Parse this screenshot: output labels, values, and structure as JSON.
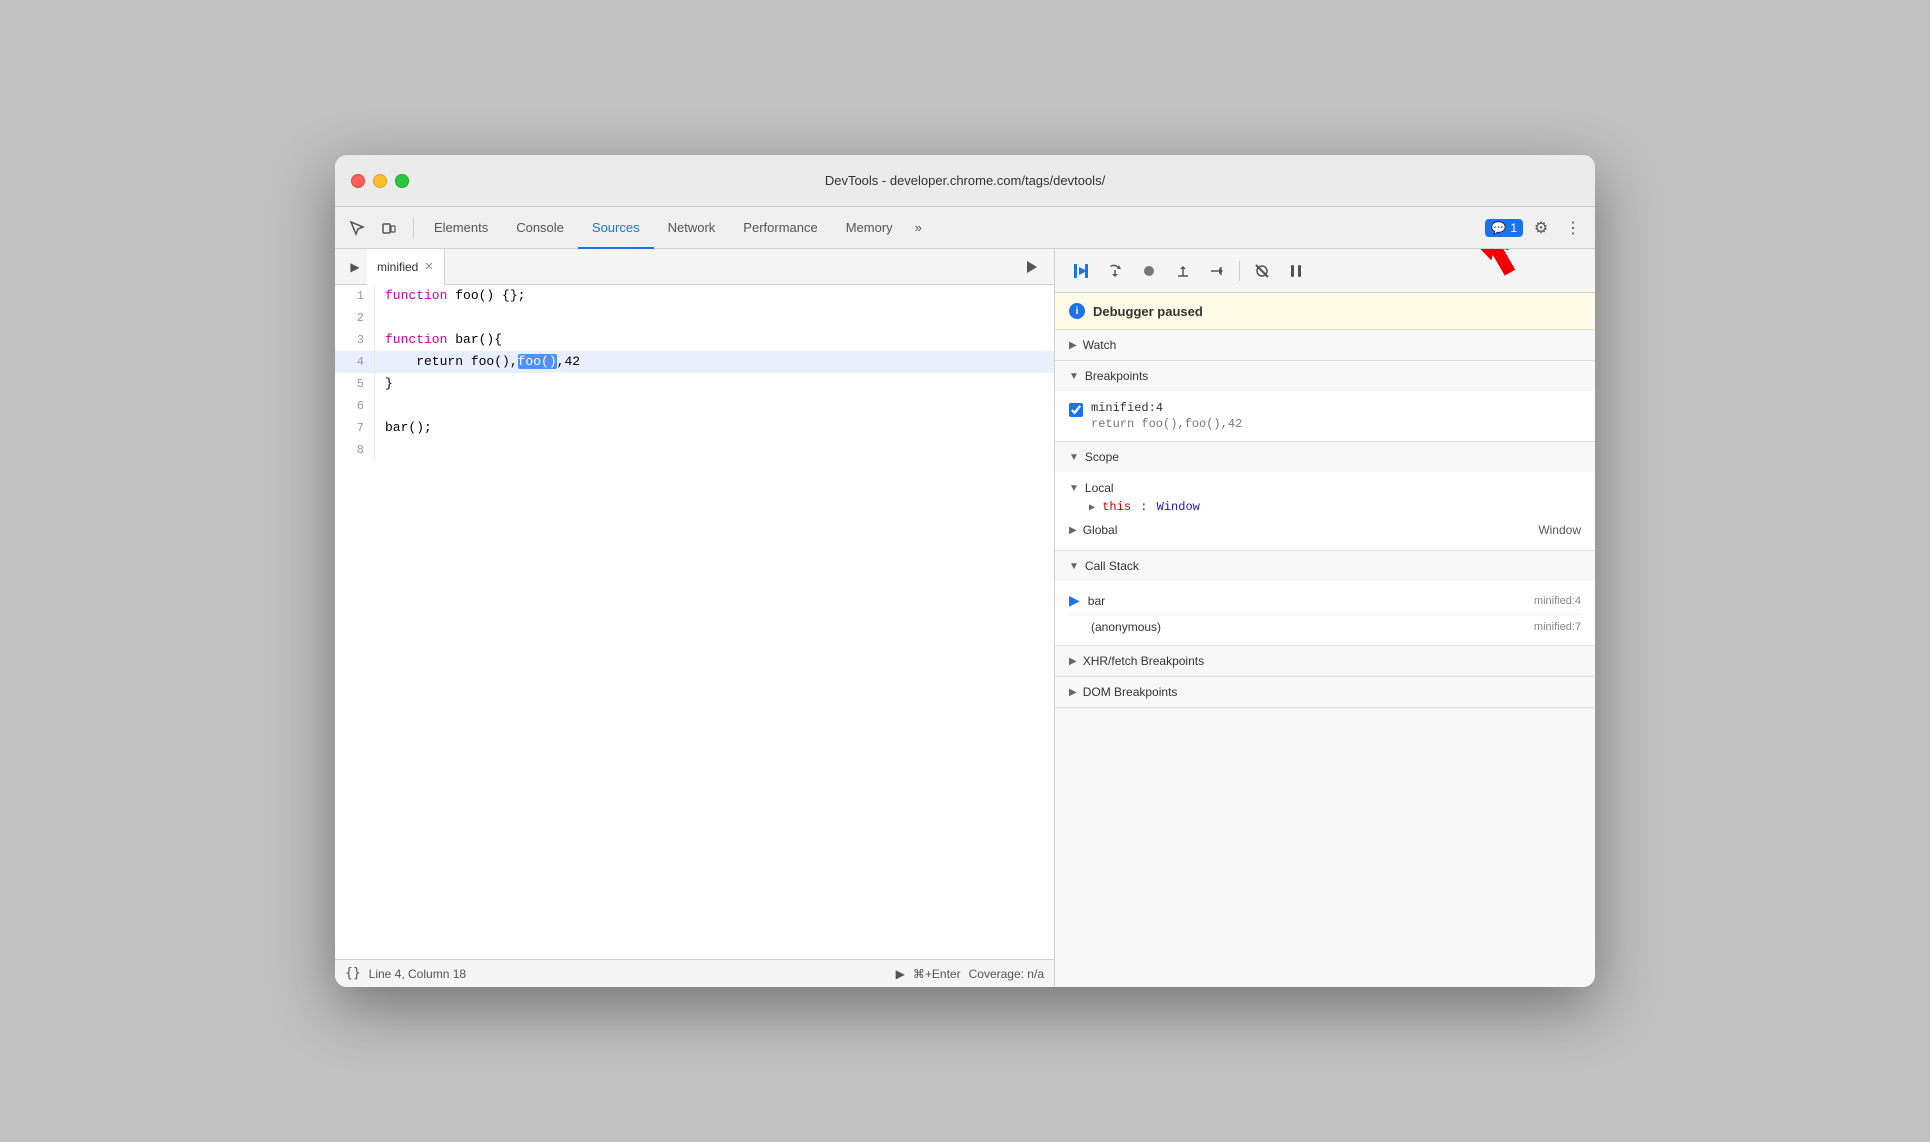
{
  "window": {
    "title": "DevTools - developer.chrome.com/tags/devtools/"
  },
  "tabs": {
    "items": [
      "Elements",
      "Console",
      "Sources",
      "Network",
      "Performance",
      "Memory"
    ],
    "active": "Sources",
    "more_label": "»",
    "badge_count": "1",
    "badge_icon": "💬"
  },
  "source_panel": {
    "file_tab": "minified",
    "code_lines": [
      {
        "num": "1",
        "content": "function foo() {};"
      },
      {
        "num": "2",
        "content": ""
      },
      {
        "num": "3",
        "content": "function bar(){"
      },
      {
        "num": "4",
        "content": "    return foo(),foo(),42",
        "highlighted": true
      },
      {
        "num": "5",
        "content": "}"
      },
      {
        "num": "6",
        "content": ""
      },
      {
        "num": "7",
        "content": "bar();"
      },
      {
        "num": "8",
        "content": ""
      }
    ],
    "status": {
      "line_col": "Line 4, Column 18",
      "run_label": "⌘+Enter",
      "run_prefix": "▶",
      "coverage": "Coverage: n/a"
    }
  },
  "debug_panel": {
    "paused_message": "Debugger paused",
    "toolbar": {
      "resume": "▶",
      "step_over": "↷",
      "step_into": "⬤",
      "step_out": "↑",
      "step": "→",
      "deactivate": "⊘",
      "pause_exceptions": "⏸"
    },
    "watch": {
      "label": "Watch",
      "expanded": false
    },
    "breakpoints": {
      "label": "Breakpoints",
      "expanded": true,
      "items": [
        {
          "file": "minified:4",
          "code": "return foo(),foo(),42",
          "checked": true
        }
      ]
    },
    "scope": {
      "label": "Scope",
      "expanded": true,
      "local": {
        "label": "Local",
        "expanded": true,
        "items": [
          {
            "key": "this",
            "value": "Window"
          }
        ]
      },
      "global": {
        "label": "Global",
        "value": "Window"
      }
    },
    "call_stack": {
      "label": "Call Stack",
      "expanded": true,
      "items": [
        {
          "name": "bar",
          "location": "minified:4",
          "is_current": true
        },
        {
          "name": "(anonymous)",
          "location": "minified:7",
          "is_current": false
        }
      ]
    },
    "xhr_breakpoints": {
      "label": "XHR/fetch Breakpoints"
    },
    "dom_breakpoints": {
      "label": "DOM Breakpoints"
    }
  }
}
